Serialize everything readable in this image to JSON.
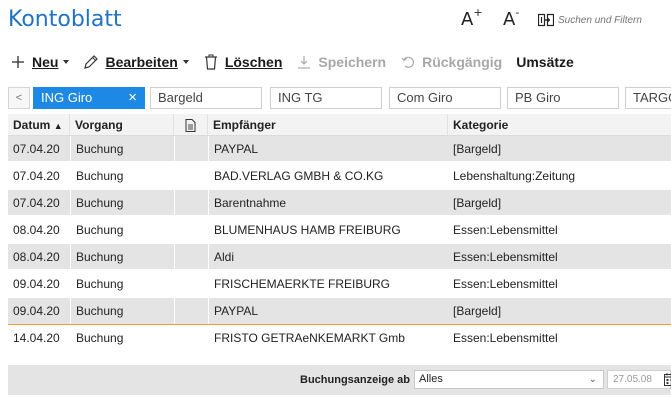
{
  "header": {
    "title": "Kontoblatt",
    "font_increase": "A",
    "font_increase_sup": "+",
    "font_decrease": "A",
    "font_decrease_sup": "-",
    "search_placeholder": "Suchen und Filtern"
  },
  "toolbar": {
    "new_label": "Neu",
    "edit_label": "Bearbeiten",
    "delete_label": "Löschen",
    "save_label": "Speichern",
    "undo_label": "Rückgängig",
    "sales_label": "Umsätze"
  },
  "tabs": {
    "scroll_left": "<",
    "close_glyph": "×",
    "items": [
      "ING Giro",
      "Bargeld",
      "ING TG",
      "Com Giro",
      "PB Giro",
      "TARGO"
    ]
  },
  "table": {
    "headers": {
      "date": "Datum",
      "date_sort": "▲",
      "type": "Vorgang",
      "recipient": "Empfänger",
      "category": "Kategorie"
    },
    "rows": [
      {
        "date": "07.04.20",
        "type": "Buchung",
        "recipient": "PAYPAL",
        "category": "[Bargeld]"
      },
      {
        "date": "07.04.20",
        "type": "Buchung",
        "recipient": "BAD.VERLAG GMBH & CO.KG",
        "category": "Lebenshaltung:Zeitung"
      },
      {
        "date": "07.04.20",
        "type": "Buchung",
        "recipient": "Barentnahme",
        "category": "[Bargeld]"
      },
      {
        "date": "08.04.20",
        "type": "Buchung",
        "recipient": "BLUMENHAUS HAMB FREIBURG",
        "category": "Essen:Lebensmittel"
      },
      {
        "date": "08.04.20",
        "type": "Buchung",
        "recipient": "Aldi",
        "category": "Essen:Lebensmittel"
      },
      {
        "date": "09.04.20",
        "type": "Buchung",
        "recipient": "FRISCHEMAERKTE  FREIBURG",
        "category": "Essen:Lebensmittel"
      },
      {
        "date": "09.04.20",
        "type": "Buchung",
        "recipient": "PAYPAL",
        "category": "[Bargeld]"
      },
      {
        "date": "14.04.20",
        "type": "Buchung",
        "recipient": "FRISTO GETRAeNKEMARKT Gmb",
        "category": "Essen:Lebensmittel"
      }
    ]
  },
  "footer": {
    "label": "Buchungsanzeige ab",
    "select_value": "Alles",
    "chevron": "⌄",
    "date_value": "27.05.08"
  },
  "colors": {
    "accent": "#1e88e5",
    "title": "#1f73c4",
    "row_alt": "#e4e4e4",
    "selection_line": "#f0a030"
  },
  "icons": {
    "search": "filter-search-icon",
    "new": "plus-icon",
    "edit": "pencil-icon",
    "delete": "trash-icon",
    "save": "download-icon",
    "undo": "undo-icon",
    "doc": "document-icon",
    "calendar": "calendar-icon"
  }
}
